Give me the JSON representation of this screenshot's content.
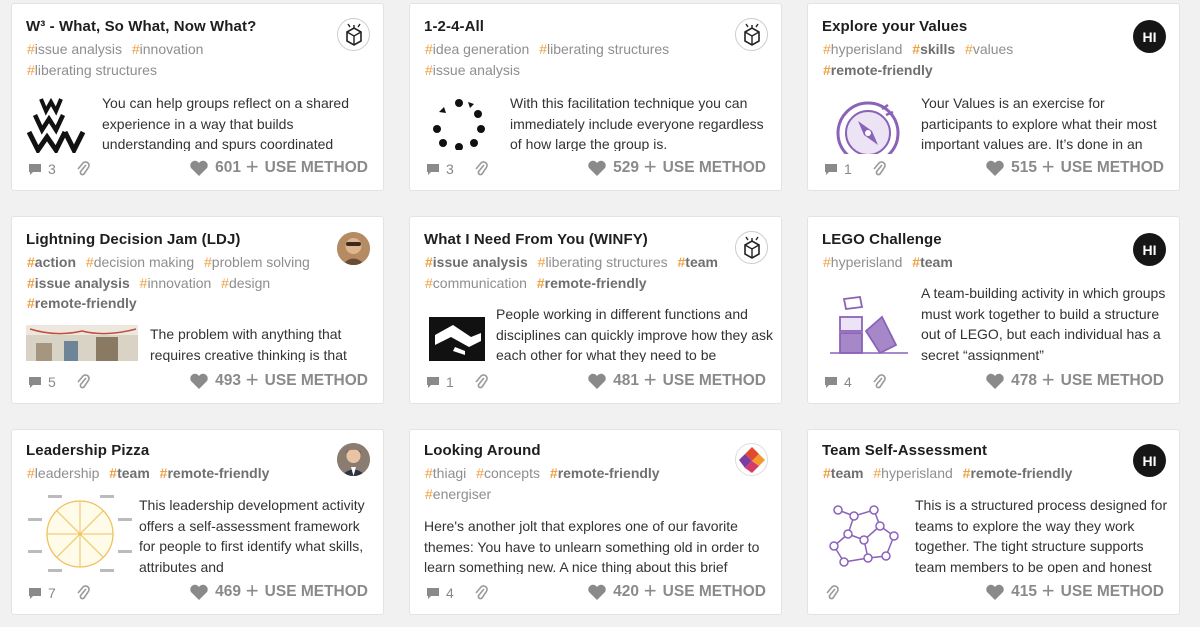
{
  "cards": [
    {
      "title": "W³ - What, So What, Now What?",
      "tags": [
        {
          "t": "issue analysis"
        },
        {
          "t": "innovation"
        },
        {
          "t": "liberating structures"
        }
      ],
      "description": "You can help groups reflect on a shared experience in a way that builds understanding and spurs coordinated",
      "comments": "3",
      "likes": "601",
      "use_label": "USE METHOD",
      "avatar": "liberating-structures-logo"
    },
    {
      "title": "1-2-4-All",
      "tags": [
        {
          "t": "idea generation"
        },
        {
          "t": "liberating structures"
        },
        {
          "t": "issue analysis"
        }
      ],
      "description": "With this facilitation technique you can immediately include everyone regardless of how large the group is.",
      "comments": "3",
      "likes": "529",
      "use_label": "USE METHOD",
      "avatar": "liberating-structures-logo"
    },
    {
      "title": "Explore your Values",
      "tags": [
        {
          "t": "hyperisland"
        },
        {
          "t": "skills",
          "strong": true
        },
        {
          "t": "values"
        },
        {
          "t": "remote-friendly",
          "strong": true
        }
      ],
      "description": "Your Values is an exercise for participants to explore what their most important values are. It’s done in an",
      "comments": "1",
      "likes": "515",
      "use_label": "USE METHOD",
      "avatar": "HI"
    },
    {
      "title": "Lightning Decision Jam (LDJ)",
      "tags": [
        {
          "t": "action",
          "strong": true
        },
        {
          "t": "decision making"
        },
        {
          "t": "problem solving"
        },
        {
          "t": "issue analysis",
          "strong": true
        },
        {
          "t": "innovation"
        },
        {
          "t": "design"
        },
        {
          "t": "remote-friendly",
          "strong": true
        }
      ],
      "description": "The problem with anything that requires creative thinking is that",
      "comments": "5",
      "likes": "493",
      "use_label": "USE METHOD",
      "avatar": "user-photo"
    },
    {
      "title": "What I Need From You (WINFY)",
      "tags": [
        {
          "t": "issue analysis",
          "strong": true
        },
        {
          "t": "liberating structures"
        },
        {
          "t": "team",
          "strong": true
        },
        {
          "t": "communication"
        },
        {
          "t": "remote-friendly",
          "strong": true
        }
      ],
      "description": "People working in different functions and disciplines can quickly improve how they ask each other for what they need to be",
      "comments": "1",
      "likes": "481",
      "use_label": "USE METHOD",
      "avatar": "liberating-structures-logo"
    },
    {
      "title": "LEGO Challenge",
      "tags": [
        {
          "t": "hyperisland"
        },
        {
          "t": "team",
          "strong": true
        }
      ],
      "description": "A team-building activity in which groups must work together to build a structure out of LEGO, but each individual has a secret “assignment”",
      "comments": "4",
      "likes": "478",
      "use_label": "USE METHOD",
      "avatar": "HI"
    },
    {
      "title": "Leadership Pizza",
      "tags": [
        {
          "t": "leadership"
        },
        {
          "t": "team",
          "strong": true
        },
        {
          "t": "remote-friendly",
          "strong": true
        }
      ],
      "description": "This leadership development activity offers a self-assessment framework for people to first identify what skills, attributes and",
      "comments": "7",
      "likes": "469",
      "use_label": "USE METHOD",
      "avatar": "user-photo"
    },
    {
      "title": "Looking Around",
      "tags": [
        {
          "t": "thiagi"
        },
        {
          "t": "concepts"
        },
        {
          "t": "remote-friendly",
          "strong": true
        },
        {
          "t": "energiser"
        }
      ],
      "description": "Here's another jolt that explores one of our favorite themes: You have to unlearn something old in order to learn something new. A nice thing about this brief",
      "comments": "4",
      "likes": "420",
      "use_label": "USE METHOD",
      "avatar": "thiagi-logo"
    },
    {
      "title": "Team Self-Assessment",
      "tags": [
        {
          "t": "team",
          "strong": true
        },
        {
          "t": "hyperisland"
        },
        {
          "t": "remote-friendly",
          "strong": true
        }
      ],
      "description": "This is a structured process designed for teams to explore the way they work together. The tight structure supports team members to be open and honest",
      "comments": "",
      "likes": "415",
      "use_label": "USE METHOD",
      "avatar": "HI"
    }
  ],
  "colors": {
    "hash": "#f0a040",
    "tag": "#8e8e8e",
    "accent_purple": "#8a63b8"
  }
}
